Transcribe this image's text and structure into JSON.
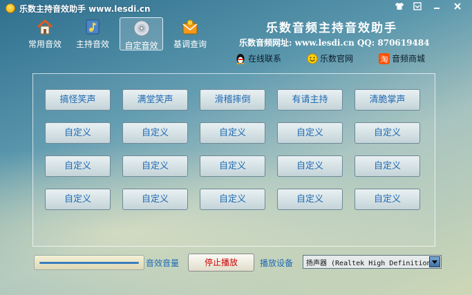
{
  "window": {
    "title": "乐数主持音效助手  www.lesdi.cn",
    "controls": [
      "shirt-icon",
      "menu-icon",
      "minimize-icon",
      "close-icon"
    ]
  },
  "toolbar": {
    "items": [
      {
        "label": "常用音效",
        "icon": "home-icon",
        "active": false
      },
      {
        "label": "主持音效",
        "icon": "music-file-icon",
        "active": false
      },
      {
        "label": "自定音效",
        "icon": "disc-icon",
        "active": true
      },
      {
        "label": "基调查询",
        "icon": "envelope-icon",
        "active": false
      }
    ]
  },
  "brand": {
    "title": "乐数音频主持音效助手",
    "site": "乐数音频网址: www.lesdi.cn  QQ: 870619484"
  },
  "links": [
    {
      "label": "在线联系",
      "icon": "qq-penguin-icon"
    },
    {
      "label": "乐数官网",
      "icon": "smiley-icon"
    },
    {
      "label": "音频商城",
      "icon": "taobao-icon"
    }
  ],
  "sound_buttons": [
    [
      "搞怪笑声",
      "满堂笑声",
      "滑稽摔倒",
      "有请主持",
      "清脆掌声"
    ],
    [
      "自定义",
      "自定义",
      "自定义",
      "自定义",
      "自定义"
    ],
    [
      "自定义",
      "自定义",
      "自定义",
      "自定义",
      "自定义"
    ],
    [
      "自定义",
      "自定义",
      "自定义",
      "自定义",
      "自定义"
    ]
  ],
  "bottom": {
    "volume_label": "音效音量",
    "volume_level_percent": 100,
    "stop_label": "停止播放",
    "device_label": "播放设备",
    "device_value": "扬声器 (Realtek High Definition Audio)"
  },
  "colors": {
    "accent_text": "#1f6ab3",
    "stop_text": "#cc0000"
  }
}
